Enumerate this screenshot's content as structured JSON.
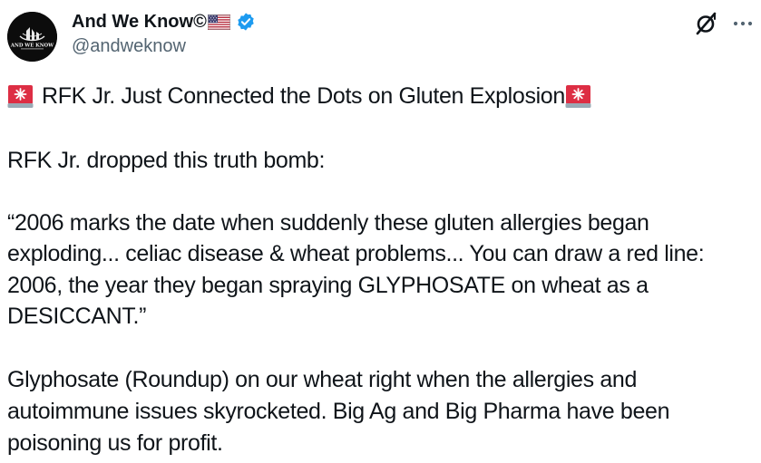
{
  "author": {
    "name": "And We Know©",
    "handle": "@andweknow",
    "avatar_text": "AND WE KNOW",
    "flag_icon": "us-flag-icon",
    "verified_icon": "verified-badge-icon"
  },
  "post": {
    "headline": "RFK Jr. Just Connected the Dots on Gluten Explosion",
    "headline_icon": "rotating-light-icon",
    "lines": [
      "RFK Jr. dropped this truth bomb:",
      "“2006 marks the date when suddenly these gluten allergies began",
      "exploding... celiac disease & wheat problems... You can draw a red line:",
      "2006, the year they began spraying GLYPHOSATE on wheat as a",
      "DESICCANT.”",
      "Glyphosate (Roundup) on our wheat  right when the allergies and",
      "autoimmune issues skyrocketed. Big Ag and Big Pharma have been",
      "poisoning us for profit."
    ]
  },
  "actions": {
    "grok_icon": "grok-icon",
    "more_icon": "more-horizontal-icon"
  },
  "colors": {
    "text": "#0f1419",
    "secondary_text": "#536471",
    "verified_blue": "#1d9bf0",
    "siren_red": "#dd2e44"
  }
}
